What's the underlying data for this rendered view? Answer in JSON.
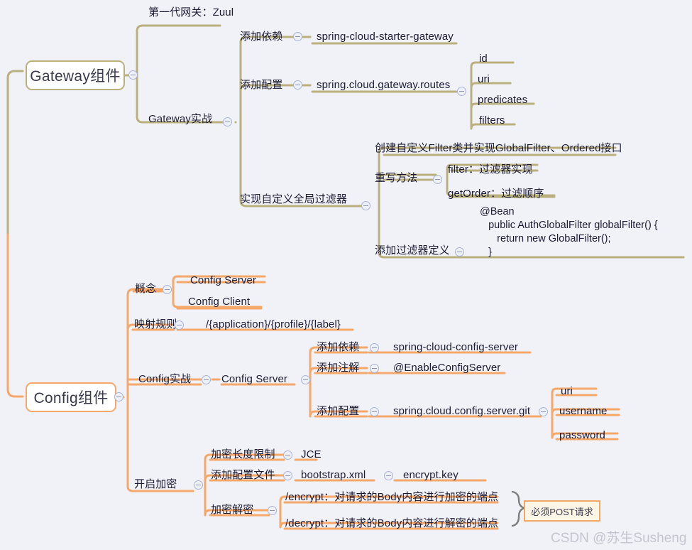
{
  "meta": {
    "background": "#f1f2f7",
    "gateway_color": "#b9b07e",
    "config_color": "#f5a86a",
    "text_color": "#1b1b33"
  },
  "watermark": "CSDN @苏生Susheng",
  "callout": {
    "label": "必须POST请求"
  },
  "roots": {
    "gateway": "Gateway组件",
    "config": "Config组件"
  },
  "nodes": {
    "zuul": "第一代网关：Zuul",
    "gateway_practice": "Gateway实战",
    "add_dependency_gw": "添加依赖",
    "starter_gateway": "spring-cloud-starter-gateway",
    "add_config_gw": "添加配置",
    "gateway_routes": "spring.cloud.gateway.routes",
    "route_id": "id",
    "route_uri": "uri",
    "route_predicates": "predicates",
    "route_filters": "filters",
    "custom_global_filter": "实现自定义全局过滤器",
    "create_filter_class": "创建自定义Filter类并实现GlobalFilter、Ordered接口",
    "override_methods": "重写方法",
    "method_filter": "filter：过滤器实现",
    "method_get_order": "getOrder：过滤顺序",
    "add_filter_definition": "添加过滤器定义",
    "filter_bean_code": "@Bean\n   public AuthGlobalFilter globalFilter() {\n      return new GlobalFilter();\n   }",
    "concept": "概念",
    "config_server_concept": "Config Server",
    "config_client_concept": "Config Client",
    "mapping_rule": "映射规则",
    "mapping_pattern": "/{application}/{profile}/{label}",
    "config_practice": "Config实战",
    "config_server": "Config Server",
    "add_dependency_cfg": "添加依赖",
    "config_server_artifact": "spring-cloud-config-server",
    "add_annotation": "添加注解",
    "enable_config_server": "@EnableConfigServer",
    "add_config_cfg": "添加配置",
    "config_server_git": "spring.cloud.config.server.git",
    "git_uri": "uri",
    "git_username": "username",
    "git_password": "password",
    "enable_encryption": "开启加密",
    "key_length_limit": "加密长度限制",
    "jce": "JCE",
    "add_config_file": "添加配置文件",
    "bootstrap_xml": "bootstrap.xml",
    "encrypt_key": "encrypt.key",
    "encrypt_decrypt": "加密解密",
    "endpoint_encrypt": "/encrypt：对请求的Body内容进行加密的端点",
    "endpoint_decrypt": "/decrypt：对请求的Body内容进行解密的端点"
  }
}
